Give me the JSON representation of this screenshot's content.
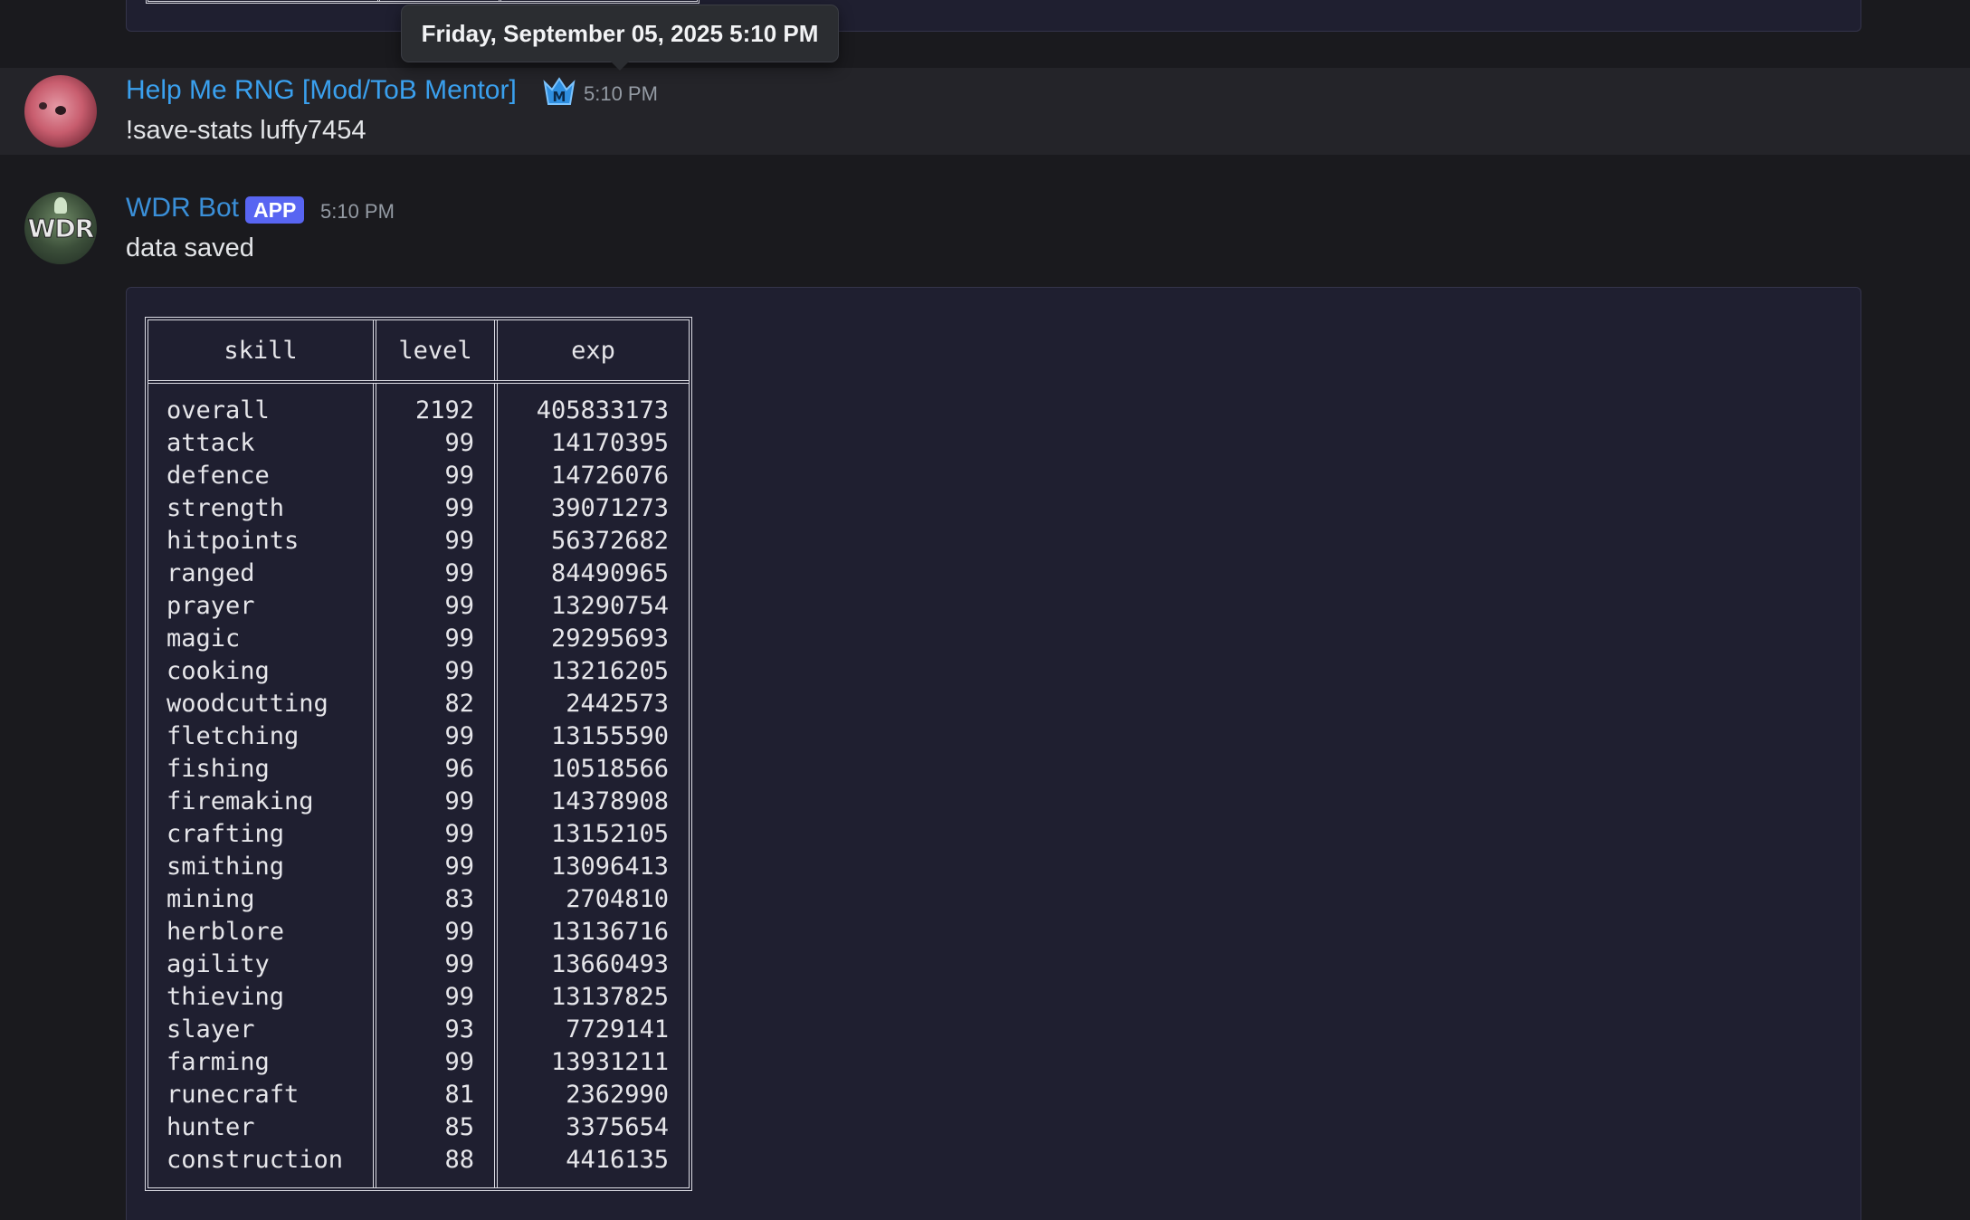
{
  "tooltip": {
    "text": "Friday, September 05, 2025 5:10 PM"
  },
  "messages": [
    {
      "username": "Help Me RNG [Mod/ToB Mentor]",
      "badge_icon": "mod-crown-icon",
      "timestamp": "5:10 PM",
      "text": "!save-stats luffy7454"
    },
    {
      "username": "WDR Bot",
      "tag": "APP",
      "avatar_text": "WDR",
      "timestamp": "5:10 PM",
      "text": "data saved"
    }
  ],
  "stats_table": {
    "headers": [
      "skill",
      "level",
      "exp"
    ],
    "rows": [
      {
        "skill": "overall",
        "level": "2192",
        "exp": "405833173"
      },
      {
        "skill": "attack",
        "level": "99",
        "exp": "14170395"
      },
      {
        "skill": "defence",
        "level": "99",
        "exp": "14726076"
      },
      {
        "skill": "strength",
        "level": "99",
        "exp": "39071273"
      },
      {
        "skill": "hitpoints",
        "level": "99",
        "exp": "56372682"
      },
      {
        "skill": "ranged",
        "level": "99",
        "exp": "84490965"
      },
      {
        "skill": "prayer",
        "level": "99",
        "exp": "13290754"
      },
      {
        "skill": "magic",
        "level": "99",
        "exp": "29295693"
      },
      {
        "skill": "cooking",
        "level": "99",
        "exp": "13216205"
      },
      {
        "skill": "woodcutting",
        "level": "82",
        "exp": "2442573"
      },
      {
        "skill": "fletching",
        "level": "99",
        "exp": "13155590"
      },
      {
        "skill": "fishing",
        "level": "96",
        "exp": "10518566"
      },
      {
        "skill": "firemaking",
        "level": "99",
        "exp": "14378908"
      },
      {
        "skill": "crafting",
        "level": "99",
        "exp": "13152105"
      },
      {
        "skill": "smithing",
        "level": "99",
        "exp": "13096413"
      },
      {
        "skill": "mining",
        "level": "83",
        "exp": "2704810"
      },
      {
        "skill": "herblore",
        "level": "99",
        "exp": "13136716"
      },
      {
        "skill": "agility",
        "level": "99",
        "exp": "13660493"
      },
      {
        "skill": "thieving",
        "level": "99",
        "exp": "13137825"
      },
      {
        "skill": "slayer",
        "level": "93",
        "exp": "7729141"
      },
      {
        "skill": "farming",
        "level": "99",
        "exp": "13931211"
      },
      {
        "skill": "runecraft",
        "level": "81",
        "exp": "2362990"
      },
      {
        "skill": "hunter",
        "level": "85",
        "exp": "3375654"
      },
      {
        "skill": "construction",
        "level": "88",
        "exp": "4416135"
      }
    ]
  },
  "colors": {
    "background": "#1a1a1e",
    "hover_row": "#242429",
    "embed": "#1f1f30",
    "username_rng": "#3aa0ee",
    "username_wdr": "#3a8fd8",
    "app_tag": "#5865f2"
  }
}
